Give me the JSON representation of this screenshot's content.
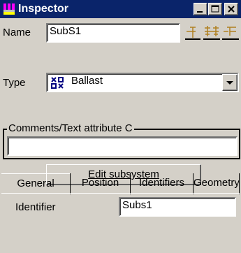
{
  "window": {
    "title": "Inspector",
    "controls": {
      "minimize": "_",
      "maximize": "□",
      "close": "×"
    }
  },
  "name_row": {
    "label": "Name",
    "value": "SubS1",
    "icons": [
      "hierarchy-up-icon",
      "hierarchy-split-icon",
      "hierarchy-down-icon"
    ]
  },
  "type_row": {
    "label": "Type",
    "value": "Ballast",
    "icon": "ballast-icon"
  },
  "comments": {
    "legend": "Comments/Text attribute C",
    "value": ""
  },
  "edit_button": {
    "label": "Edit subsystem"
  },
  "tabs": [
    {
      "label": "General",
      "active": true
    },
    {
      "label": "Position",
      "active": false
    },
    {
      "label": "Identifiers",
      "active": false
    },
    {
      "label": "Geometry",
      "active": false
    }
  ],
  "general": {
    "identifier_label": "Identifier",
    "identifier_value": "Subs1"
  },
  "colors": {
    "titlebar": "#0a246a",
    "face": "#d4d0c8",
    "accent_icons": "#b08020"
  }
}
